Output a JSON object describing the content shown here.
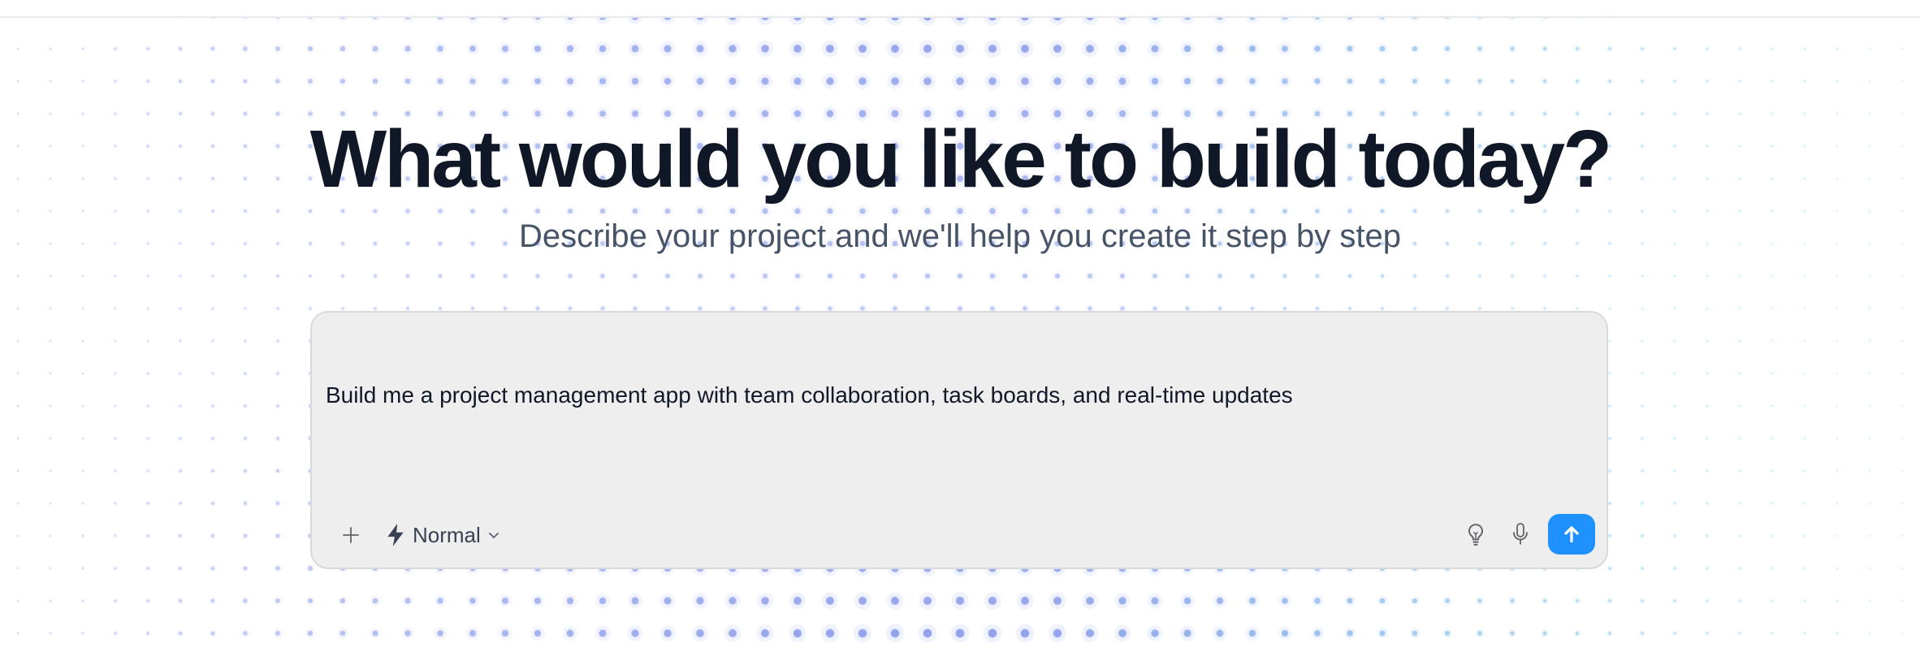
{
  "hero": {
    "headline": "What would you like to build today?",
    "subtitle": "Describe your project and we'll help you create it step by step"
  },
  "prompt": {
    "value": "Build me a project management app with team collaboration, task boards, and real-time updates"
  },
  "toolbar": {
    "attach_icon": "plus-icon",
    "mode_icon": "lightning-bolt-icon",
    "mode_label": "Normal",
    "mode_chevron_icon": "chevron-down-icon",
    "idea_icon": "lightbulb-icon",
    "mic_icon": "microphone-icon",
    "send_icon": "arrow-up-icon"
  },
  "colors": {
    "headline": "#101828",
    "subtitle": "#475467",
    "prompt_background": "#eeeeee",
    "prompt_border": "#d9d9dc",
    "send_button": "#1e90ff",
    "dot_blue": "#7b8fe6",
    "dot_teal": "#6fd3e8"
  }
}
